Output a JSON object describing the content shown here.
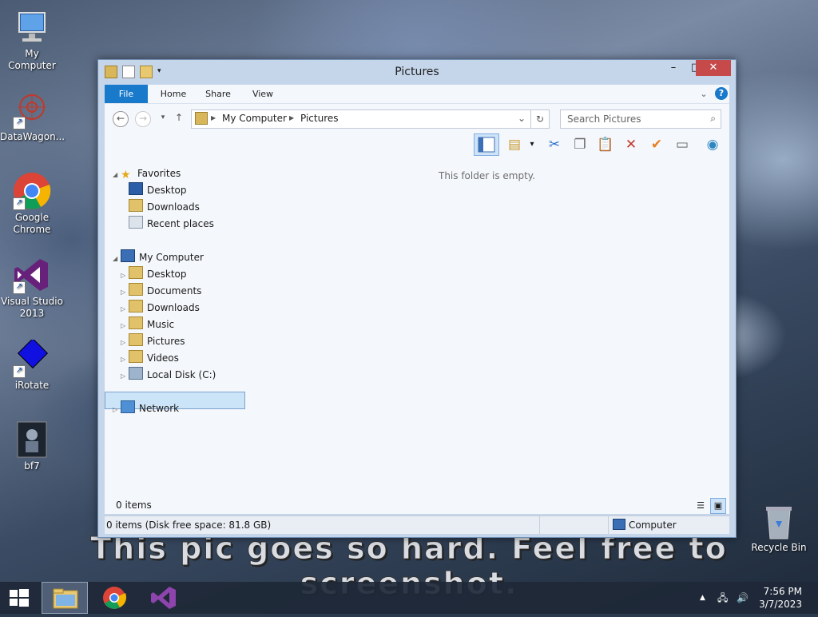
{
  "desktop": {
    "icons": [
      {
        "label": "My Computer"
      },
      {
        "label": "DataWagon..."
      },
      {
        "label": "Google Chrome"
      },
      {
        "label": "Visual Studio 2013"
      },
      {
        "label": "iRotate"
      },
      {
        "label": "bf7"
      },
      {
        "label": "Recycle Bin"
      }
    ],
    "caption_line1": "This pic goes so hard. Feel free to",
    "caption_line2": "screenshot."
  },
  "window": {
    "title": "Pictures",
    "tabs": [
      "File",
      "Home",
      "Share",
      "View"
    ],
    "address": {
      "root": "My Computer",
      "current": "Pictures"
    },
    "search_placeholder": "Search Pictures",
    "empty_message": "This folder is empty.",
    "tree": {
      "favorites": {
        "label": "Favorites",
        "items": [
          "Desktop",
          "Downloads",
          "Recent places"
        ]
      },
      "computer": {
        "label": "My Computer",
        "items": [
          "Desktop",
          "Documents",
          "Downloads",
          "Music",
          "Pictures",
          "Videos",
          "Local Disk (C:)"
        ]
      },
      "network": {
        "label": "Network"
      }
    },
    "selected_item": "Pictures",
    "item_count": "0 items",
    "status_info": "0 items (Disk free space: 81.8 GB)",
    "status_location": "Computer"
  },
  "taskbar": {
    "time": "7:56 PM",
    "date": "3/7/2023"
  },
  "colors": {
    "file_tab": "#1979ca",
    "close_button": "#c74a4a",
    "selection": "#cce4f7"
  }
}
